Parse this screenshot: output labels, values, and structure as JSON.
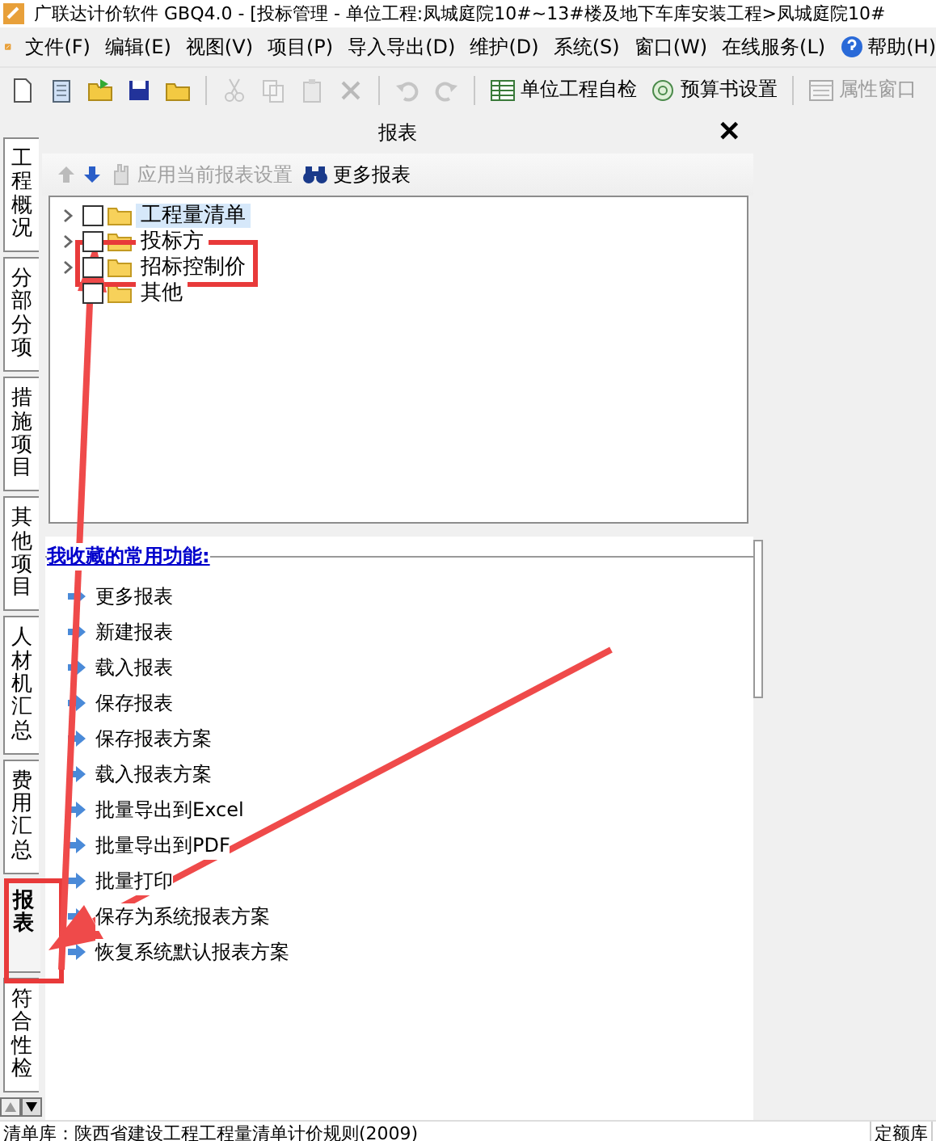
{
  "window": {
    "title": "广联达计价软件 GBQ4.0 - [投标管理 - 单位工程:凤城庭院10#~13#楼及地下车库安装工程>凤城庭院10#"
  },
  "menu": [
    "文件(F)",
    "编辑(E)",
    "视图(V)",
    "项目(P)",
    "导入导出(D)",
    "维护(D)",
    "系统(S)",
    "窗口(W)",
    "在线服务(L)",
    "帮助(H)"
  ],
  "toolbar": {
    "icon_buttons": [
      {
        "disabled": false
      },
      {
        "disabled": false
      },
      {
        "disabled": false
      },
      {
        "disabled": false
      },
      {
        "disabled": false
      },
      {
        "disabled": true
      },
      {
        "disabled": true
      },
      {
        "disabled": true
      },
      {
        "disabled": true
      },
      {
        "disabled": true
      },
      {
        "disabled": true
      }
    ],
    "text_buttons": [
      {
        "label": "单位工程自检",
        "disabled": false
      },
      {
        "label": "预算书设置",
        "disabled": false
      },
      {
        "label": "属性窗口",
        "disabled": true
      }
    ]
  },
  "side_tabs": [
    {
      "label": "工程概况",
      "selected": false
    },
    {
      "label": "分部分项",
      "selected": false
    },
    {
      "label": "措施项目",
      "selected": false
    },
    {
      "label": "其他项目",
      "selected": false
    },
    {
      "label": "人材机汇总",
      "selected": false
    },
    {
      "label": "费用汇总",
      "selected": false
    },
    {
      "label": "报表",
      "selected": true
    },
    {
      "label": "符合性检",
      "selected": false
    }
  ],
  "panel": {
    "title": "报表",
    "close": "✕",
    "tools": [
      {
        "label": "应用当前报表设置",
        "disabled": true
      },
      {
        "label": "更多报表",
        "disabled": false
      }
    ],
    "tree": [
      {
        "label": "工程量清单",
        "checked": false,
        "selected": true,
        "expandable": true
      },
      {
        "label": "投标方",
        "checked": false,
        "selected": false,
        "expandable": true
      },
      {
        "label": "招标控制价",
        "checked": false,
        "selected": false,
        "expandable": true
      },
      {
        "label": "其他",
        "checked": false,
        "selected": false,
        "expandable": false
      }
    ],
    "favorites_title": "我收藏的常用功能:",
    "favorites": [
      "更多报表",
      "新建报表",
      "载入报表",
      "保存报表",
      "保存报表方案",
      "载入报表方案",
      "批量导出到Excel",
      "批量导出到PDF",
      "批量打印",
      "保存为系统报表方案",
      "恢复系统默认报表方案"
    ]
  },
  "status_bar": [
    "清单库：陕西省建设工程工程量清单计价规则(2009)",
    "定额库"
  ]
}
